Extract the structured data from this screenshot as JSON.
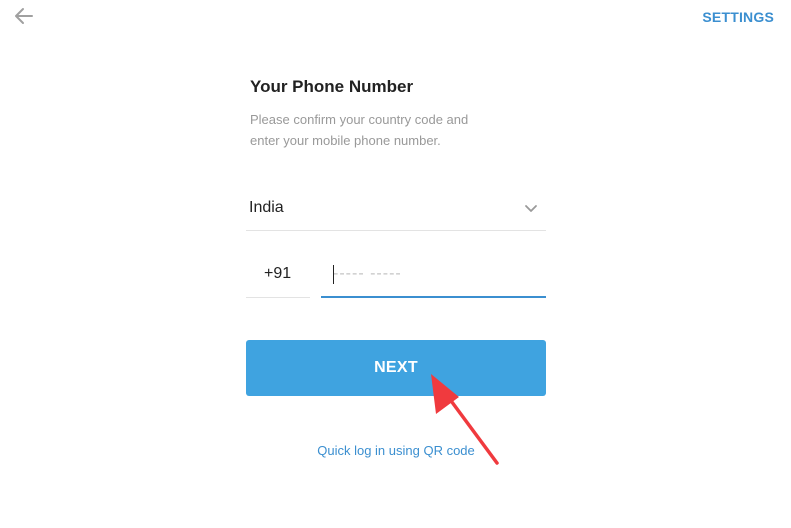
{
  "header": {
    "back_icon": "arrow-left-icon",
    "settings_label": "SETTINGS"
  },
  "login": {
    "title": "Your Phone Number",
    "subtitle": "Please confirm your country code and enter your mobile phone number.",
    "country": "India",
    "country_code": "+91",
    "phone_value": "",
    "phone_placeholder": "----- -----",
    "next_label": "NEXT",
    "qr_link": "Quick log in using QR code"
  },
  "colors": {
    "accent": "#3b8fd0",
    "button": "#3fa3e0",
    "annotation_arrow": "#f03a3e"
  }
}
